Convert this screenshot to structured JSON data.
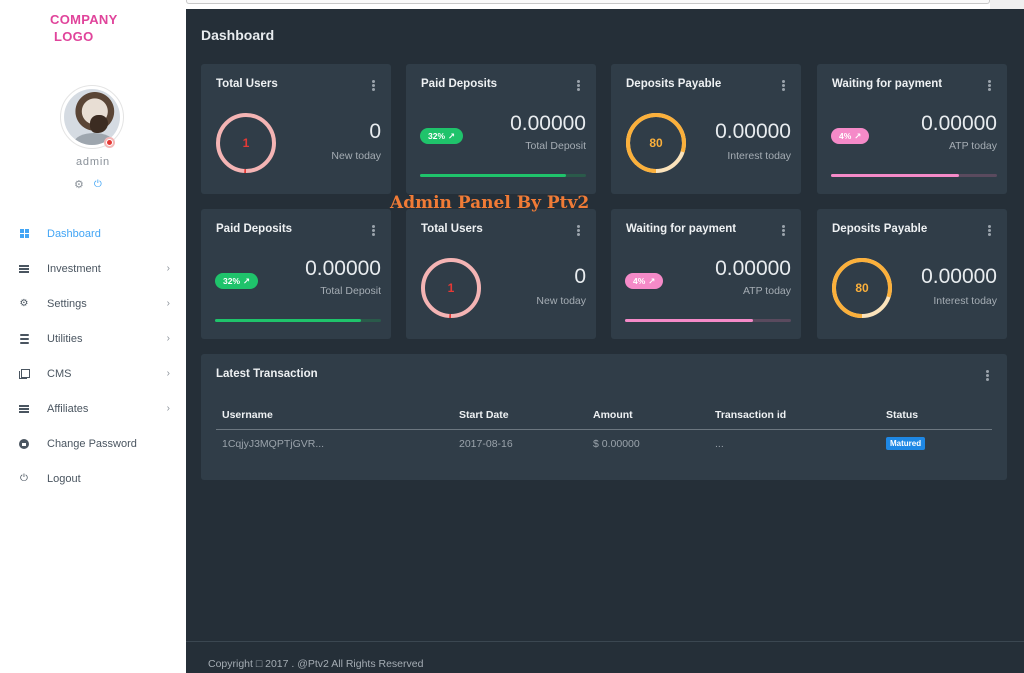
{
  "brand": {
    "logo_line1": "COMPANY",
    "logo_line2": "LOGO",
    "logo_color": "#e0449b"
  },
  "user": {
    "name": "admin",
    "status": "online",
    "actions": [
      "gear-icon",
      "power-icon"
    ]
  },
  "sidebar": {
    "items": [
      {
        "label": "Dashboard",
        "icon": "dashboard-icon",
        "active": true,
        "has_submenu": false
      },
      {
        "label": "Investment",
        "icon": "list-icon",
        "active": false,
        "has_submenu": true
      },
      {
        "label": "Settings",
        "icon": "gear-icon",
        "active": false,
        "has_submenu": true
      },
      {
        "label": "Utilities",
        "icon": "database-icon",
        "active": false,
        "has_submenu": true
      },
      {
        "label": "CMS",
        "icon": "copy-icon",
        "active": false,
        "has_submenu": true
      },
      {
        "label": "Affiliates",
        "icon": "list-icon",
        "active": false,
        "has_submenu": true
      },
      {
        "label": "Change Password",
        "icon": "lock-icon",
        "active": false,
        "has_submenu": false
      },
      {
        "label": "Logout",
        "icon": "power-icon",
        "active": false,
        "has_submenu": false
      }
    ],
    "chevron": "›"
  },
  "page": {
    "title": "Dashboard"
  },
  "watermark": "Admin Panel By Ptv2",
  "cards": [
    {
      "title": "Total Users",
      "type": "ring",
      "ring_value": "1",
      "ring_fraction": 0.01,
      "ring_color": "#f4b4b4",
      "ring_accent": "#e53935",
      "value": "0",
      "sub": "New today"
    },
    {
      "title": "Paid Deposits",
      "type": "badge",
      "badge": "32%",
      "badge_color": "#1fc36b",
      "value": "0.00000",
      "sub": "Total Deposit",
      "bar_fraction": 0.88,
      "bar_color": "#1fc36b",
      "bar_track": "#2a5a4a"
    },
    {
      "title": "Deposits Payable",
      "type": "ring",
      "ring_value": "80",
      "ring_fraction": 0.8,
      "ring_color": "#fbb03b",
      "ring_accent": "#fbe3bb",
      "value": "0.00000",
      "sub": "Interest today"
    },
    {
      "title": "Waiting for payment",
      "type": "badge",
      "badge": "4%",
      "badge_color": "#f58ac8",
      "value": "0.00000",
      "sub": "ATP today",
      "bar_fraction": 0.77,
      "bar_color": "#f58ac8",
      "bar_track": "#5a4a5e"
    },
    {
      "title": "Paid Deposits",
      "type": "badge",
      "badge": "32%",
      "badge_color": "#1fc36b",
      "value": "0.00000",
      "sub": "Total Deposit",
      "bar_fraction": 0.88,
      "bar_color": "#1fc36b",
      "bar_track": "#2a5a4a"
    },
    {
      "title": "Total Users",
      "type": "ring",
      "ring_value": "1",
      "ring_fraction": 0.01,
      "ring_color": "#f4b4b4",
      "ring_accent": "#e53935",
      "value": "0",
      "sub": "New today"
    },
    {
      "title": "Waiting for payment",
      "type": "badge",
      "badge": "4%",
      "badge_color": "#f58ac8",
      "value": "0.00000",
      "sub": "ATP today",
      "bar_fraction": 0.77,
      "bar_color": "#f58ac8",
      "bar_track": "#5a4a5e"
    },
    {
      "title": "Deposits Payable",
      "type": "ring",
      "ring_value": "80",
      "ring_fraction": 0.8,
      "ring_color": "#fbb03b",
      "ring_accent": "#fbe3bb",
      "value": "0.00000",
      "sub": "Interest today"
    }
  ],
  "transactions": {
    "title": "Latest Transaction",
    "columns": [
      "Username",
      "Start Date",
      "Amount",
      "Transaction id",
      "Status"
    ],
    "rows": [
      {
        "username": "1CqjyJ3MQPTjGVR...",
        "start_date": "2017-08-16",
        "amount": "$ 0.00000",
        "transaction_id": "...",
        "status": "Matured"
      }
    ]
  },
  "footer": {
    "text": "Copyright □ 2017 . @Ptv2 All Rights Reserved"
  }
}
